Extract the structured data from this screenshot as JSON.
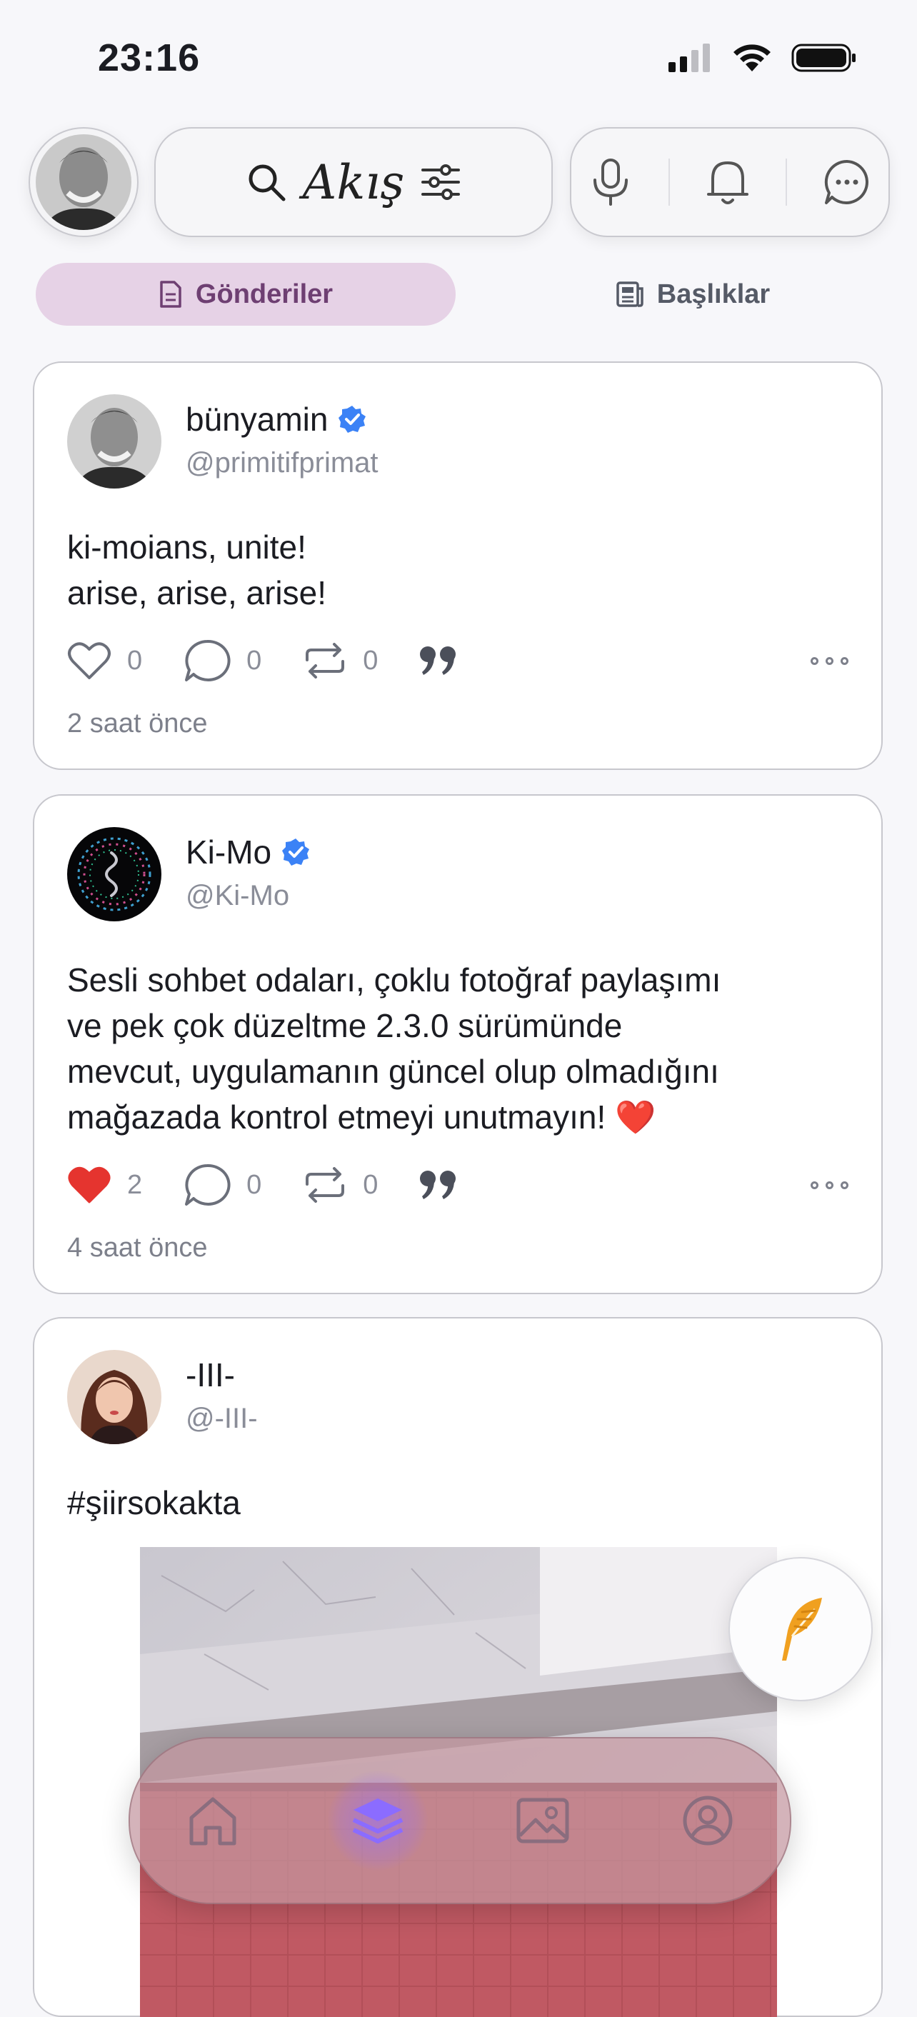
{
  "status_bar": {
    "time": "23:16"
  },
  "header": {
    "title": "Akış"
  },
  "tabs": [
    {
      "label": "Gönderiler",
      "active": true
    },
    {
      "label": "Başlıklar",
      "active": false
    }
  ],
  "posts": [
    {
      "name": "bünyamin",
      "verified": true,
      "handle": "@primitifprimat",
      "text": "ki-moians, unite!\narise, arise, arise!",
      "likes": "0",
      "liked": false,
      "comments": "0",
      "reposts": "0",
      "time": "2 saat önce"
    },
    {
      "name": "Ki-Mo",
      "verified": true,
      "handle": "@Ki-Mo",
      "text": "Sesli sohbet odaları, çoklu fotoğraf paylaşımı\nve pek çok düzeltme 2.3.0 sürümünde\nmevcut, uygulamanın güncel olup olmadığını\nmağazada kontrol etmeyi unutmayın! ❤️",
      "likes": "2",
      "liked": true,
      "comments": "0",
      "reposts": "0",
      "time": "4 saat önce"
    },
    {
      "name": "-III-",
      "verified": false,
      "handle": "@-III-",
      "text": "#şiirsokakta"
    }
  ],
  "colors": {
    "accent": "#6e3f72",
    "tab_active_bg": "#e6d2e6",
    "verified": "#3b82f6",
    "like_active": "#e5342f",
    "fab_icon": "#f0a020",
    "nav_active": "#8b6cff"
  },
  "icons": {
    "header": [
      "search-icon",
      "filter-icon",
      "microphone-icon",
      "bell-icon",
      "chat-icon"
    ],
    "tabs": [
      "document-icon",
      "newspaper-icon"
    ],
    "post_actions": [
      "heart-icon",
      "comment-icon",
      "repost-icon",
      "quote-icon",
      "more-icon"
    ],
    "fab": "feather-icon",
    "bottom_nav": [
      "home-icon",
      "layers-icon",
      "image-icon",
      "profile-icon"
    ]
  }
}
